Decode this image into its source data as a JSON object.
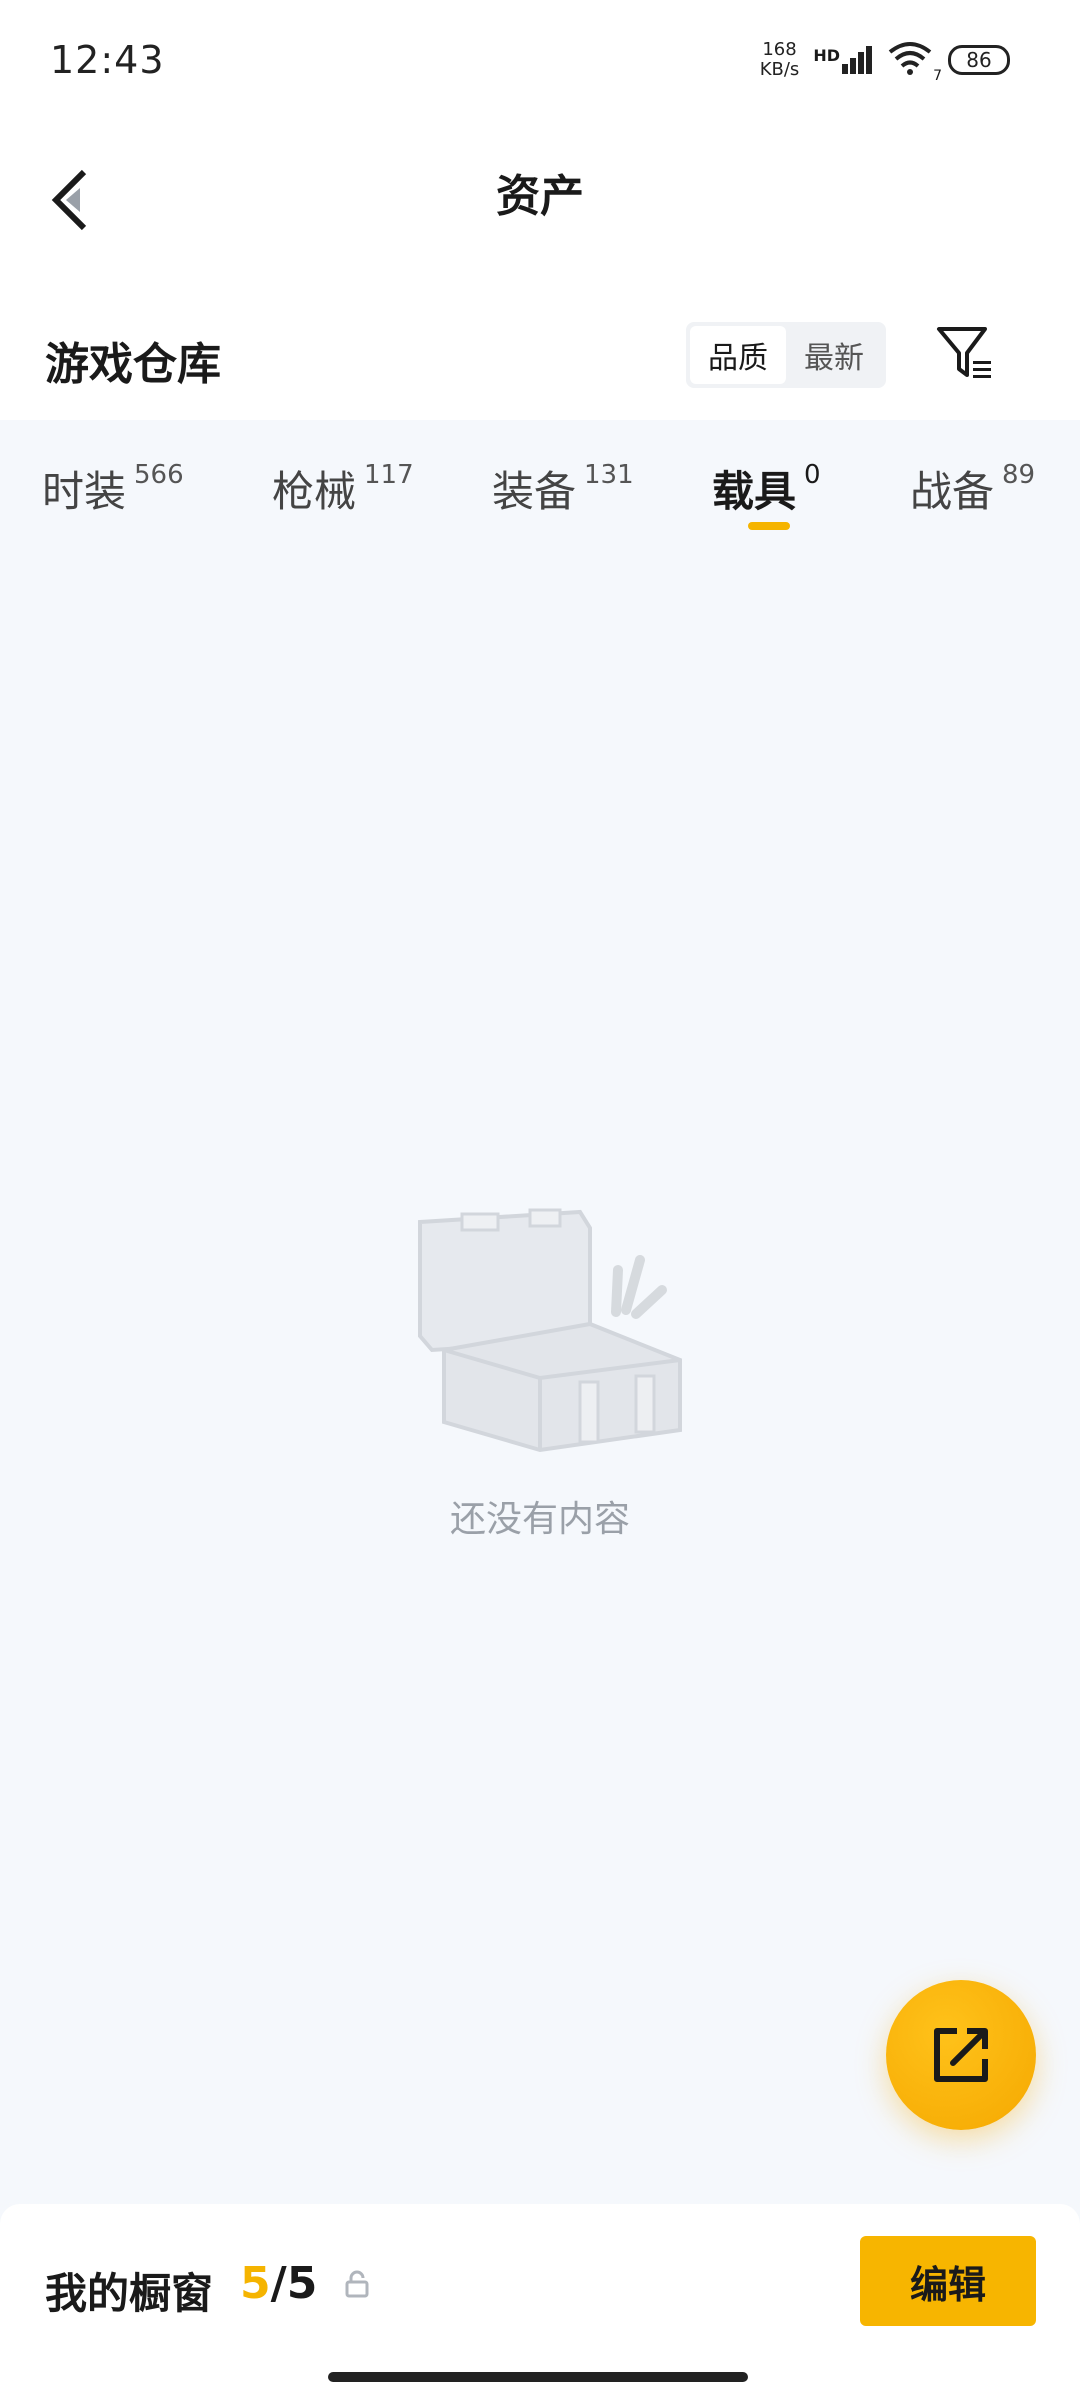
{
  "status": {
    "time": "12:43",
    "net_speed_value": "168",
    "net_speed_unit": "KB/s",
    "net_type": "HD",
    "wifi_badge": "7",
    "battery": "86"
  },
  "nav": {
    "title": "资产"
  },
  "section": {
    "title": "游戏仓库",
    "sort_options": [
      "品质",
      "最新"
    ],
    "sort_selected": "品质"
  },
  "tabs": [
    {
      "label": "时装",
      "count": "566"
    },
    {
      "label": "枪械",
      "count": "117"
    },
    {
      "label": "装备",
      "count": "131"
    },
    {
      "label": "载具",
      "count": "0"
    },
    {
      "label": "战备",
      "count": "89"
    }
  ],
  "active_tab": "载具",
  "empty": {
    "text": "还没有内容"
  },
  "bottom": {
    "label": "我的橱窗",
    "current": "5",
    "total": "/5",
    "edit_label": "编辑"
  },
  "colors": {
    "accent": "#f5b400",
    "background": "#f5f8fc"
  }
}
